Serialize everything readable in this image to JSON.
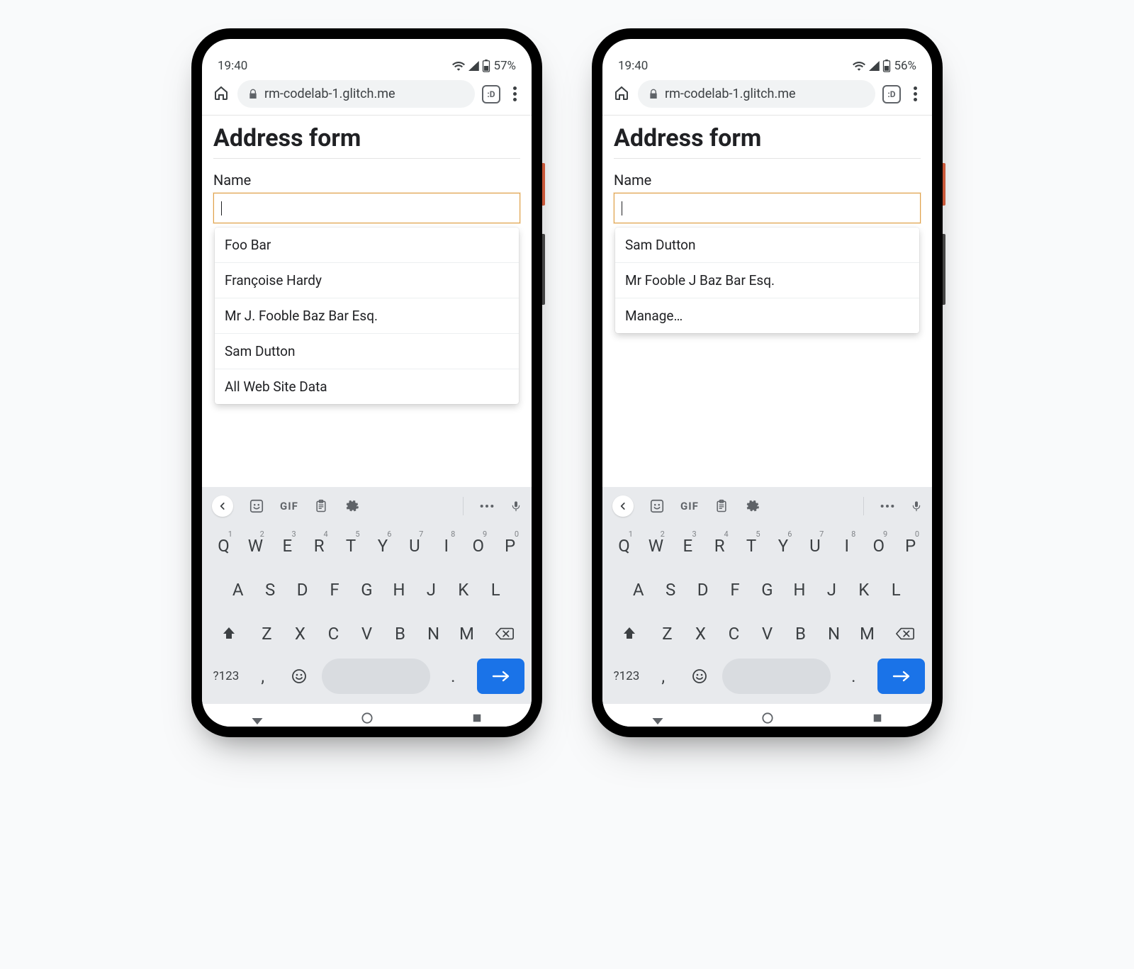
{
  "phones": [
    {
      "statusbar": {
        "time": "19:40",
        "battery": "57%"
      },
      "browser": {
        "url": "rm-codelab-1.glitch.me",
        "tab_count": ":D"
      },
      "page": {
        "title": "Address form",
        "name_label": "Name",
        "suggestions": [
          "Foo Bar",
          "Françoise Hardy",
          "Mr J. Fooble Baz Bar Esq.",
          "Sam Dutton",
          "All Web Site Data"
        ]
      }
    },
    {
      "statusbar": {
        "time": "19:40",
        "battery": "56%"
      },
      "browser": {
        "url": "rm-codelab-1.glitch.me",
        "tab_count": ":D"
      },
      "page": {
        "title": "Address form",
        "name_label": "Name",
        "suggestions": [
          "Sam Dutton",
          "Mr Fooble J Baz Bar Esq.",
          "Manage…"
        ]
      }
    }
  ],
  "keyboard": {
    "toolbar_gif": "GIF",
    "row1": [
      {
        "k": "Q",
        "s": "1"
      },
      {
        "k": "W",
        "s": "2"
      },
      {
        "k": "E",
        "s": "3"
      },
      {
        "k": "R",
        "s": "4"
      },
      {
        "k": "T",
        "s": "5"
      },
      {
        "k": "Y",
        "s": "6"
      },
      {
        "k": "U",
        "s": "7"
      },
      {
        "k": "I",
        "s": "8"
      },
      {
        "k": "O",
        "s": "9"
      },
      {
        "k": "P",
        "s": "0"
      }
    ],
    "row2": [
      "A",
      "S",
      "D",
      "F",
      "G",
      "H",
      "J",
      "K",
      "L"
    ],
    "row3": [
      "Z",
      "X",
      "C",
      "V",
      "B",
      "N",
      "M"
    ],
    "symkey": "?123",
    "comma": ",",
    "period": "."
  }
}
